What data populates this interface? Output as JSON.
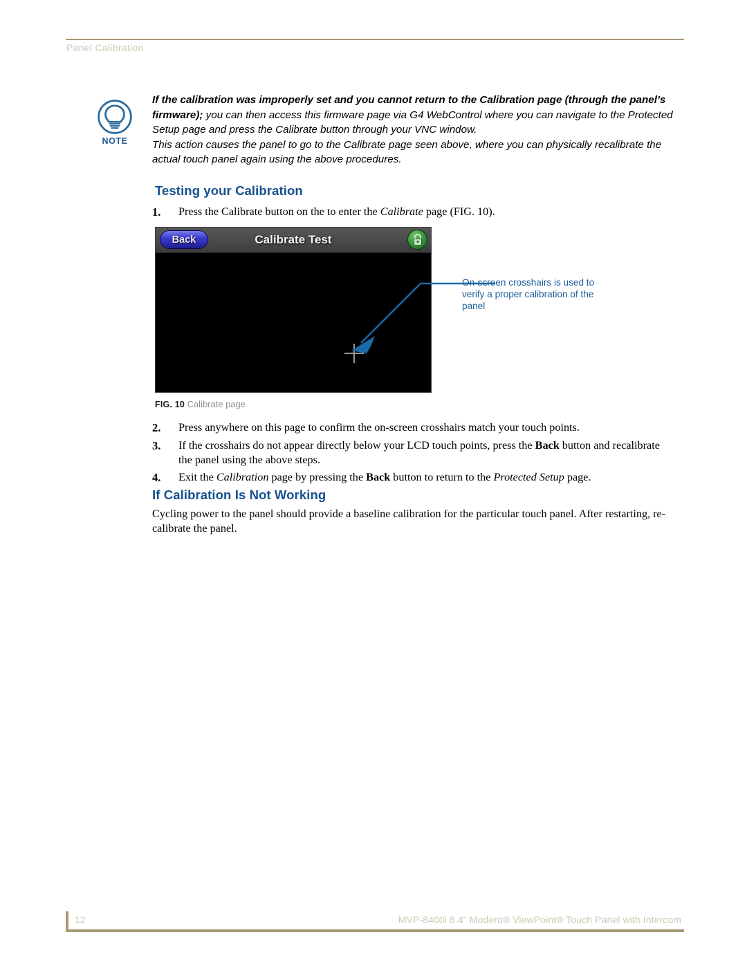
{
  "page": {
    "running_header": "Panel Calibration",
    "page_number": "12",
    "footer_document": "MVP-8400i 8.4\" Modero® ViewPoint® Touch Panel with Intercom"
  },
  "note": {
    "icon_label": "NOTE",
    "bold_part": "If the calibration was improperly set and you cannot return to the Calibration page (through the panel’s firmware);",
    "rest_part": " you can then access this firmware page via G4 WebControl where you can navigate to the Protected Setup page and press the Calibrate button through your VNC window.",
    "second_paragraph": "This action causes the panel to go to the Calibrate page seen above, where you can physically recalibrate the actual touch panel again using the above procedures."
  },
  "section_testing": {
    "heading": "Testing your Calibration",
    "step1": {
      "number": "1.",
      "part_a": "Press the Calibrate button on the to enter the ",
      "italic": "Calibrate",
      "part_b": " page (FIG. 10)."
    },
    "step2": {
      "number": "2.",
      "text": "Press anywhere on this page to confirm the on-screen crosshairs match your touch points."
    },
    "step3": {
      "number": "3.",
      "part_a": "If the crosshairs do not appear directly below your LCD touch points, press the ",
      "bold": "Back",
      "part_b": " button and recalibrate the panel using the above steps."
    },
    "step4": {
      "number": "4.",
      "part_a": "Exit the ",
      "italic_a": "Calibration",
      "part_b": " page by pressing the ",
      "bold": "Back",
      "part_c": " button to return to the ",
      "italic_b": "Protected Setup",
      "part_d": " page."
    }
  },
  "figure": {
    "panel": {
      "back_button": "Back",
      "title": "Calibrate Test",
      "lock_icon": "padlock-icon",
      "crosshair_icon": "crosshair-icon"
    },
    "callout": "On-screen crosshairs is used to verify a proper calibration of the panel",
    "caption_number": "FIG. 10",
    "caption_text": "Calibrate page"
  },
  "section_notworking": {
    "heading": "If Calibration Is Not Working",
    "paragraph": "Cycling power to the panel should provide a baseline calibration for the particular touch panel.  After restarting, re-calibrate the panel."
  },
  "colors": {
    "heading_blue": "#16508f",
    "callout_blue": "#1b5c9b",
    "rule_tan": "#a79a76",
    "header_text_tan": "#cfc8b6",
    "note_icon_blue": "#1d5c8f"
  }
}
